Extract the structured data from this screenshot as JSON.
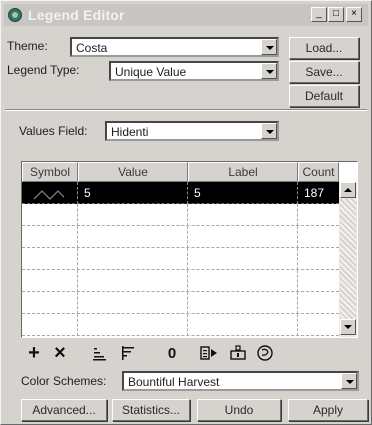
{
  "window": {
    "title": "Legend Editor",
    "controls": {
      "minimize": "_",
      "maximize": "□",
      "close": "×"
    }
  },
  "theme": {
    "label": "Theme:",
    "value": "Costa"
  },
  "legend_type": {
    "label": "Legend Type:",
    "value": "Unique Value"
  },
  "values_field": {
    "label": "Values Field:",
    "value": "Hidenti"
  },
  "buttons": {
    "load": "Load...",
    "save": "Save...",
    "default": "Default"
  },
  "table": {
    "columns": [
      "Symbol",
      "Value",
      "Label",
      "Count"
    ],
    "rows": [
      {
        "symbol": "line-symbol",
        "value": "5",
        "label": "5",
        "count": "187",
        "selected": true
      }
    ]
  },
  "toolbar": {
    "icons": [
      "add-icon",
      "delete-icon",
      "sort-ascending-icon",
      "sort-descending-icon",
      "null-value-icon",
      "properties-icon",
      "flip-icon",
      "reset-icon"
    ],
    "add_glyph": "+",
    "delete_glyph": "×",
    "null_glyph": "0"
  },
  "color_schemes": {
    "label": "Color Schemes:",
    "value": "Bountiful Harvest"
  },
  "bottom_buttons": {
    "advanced": "Advanced...",
    "statistics": "Statistics...",
    "undo": "Undo",
    "apply": "Apply"
  },
  "colors": {
    "title_bar": "#c8c6c2",
    "dialog_bg": "#d6d3ce",
    "selection": "#000000"
  }
}
